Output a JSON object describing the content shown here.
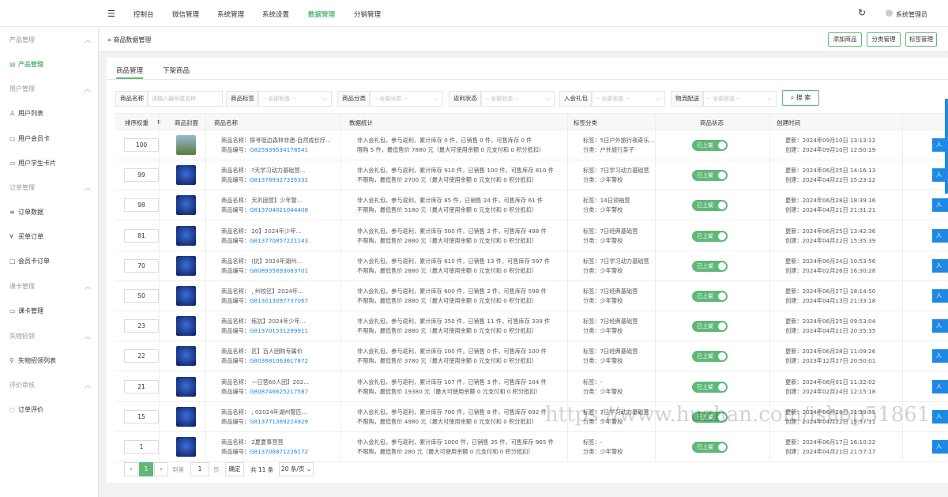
{
  "topbar": {
    "nav": [
      "控制台",
      "微信管理",
      "系统管理",
      "系统设置",
      "数据管理",
      "分销管理"
    ],
    "active_nav": "数据管理",
    "username": "系统管理员"
  },
  "sidebar": {
    "sections": [
      {
        "title": "产品管理",
        "items": [
          "产品管理"
        ]
      },
      {
        "title": "用户管理",
        "items": [
          "用户列表",
          "用户会员卡",
          "用户学生卡片"
        ]
      },
      {
        "title": "订单管理",
        "items": [
          "订单数据",
          "买单订单",
          "会员卡订单"
        ]
      },
      {
        "title": "课卡管理",
        "items": [
          "课卡管理"
        ]
      },
      {
        "title": "失物招领",
        "items": [
          "失物招领列表"
        ]
      },
      {
        "title": "评价审核",
        "items": [
          "订单评价"
        ]
      }
    ],
    "active_item": "产品管理"
  },
  "breadcrumb": "商品数据管理",
  "header_buttons": [
    "添加商品",
    "分类管理",
    "标签管理"
  ],
  "tabs": [
    "商品管理",
    "下架商品"
  ],
  "filters": [
    {
      "label": "商品名称",
      "placeholder": "请输入编号或名称"
    },
    {
      "label": "商品标签",
      "placeholder": "-- 全部标签 --"
    },
    {
      "label": "商品分类",
      "placeholder": "-- 全部分类 --"
    },
    {
      "label": "返利状态",
      "placeholder": "-- 全部状态 --"
    },
    {
      "label": "入会礼包",
      "placeholder": "-- 全部状态 --"
    },
    {
      "label": "物流配送",
      "placeholder": "-- 全部状态 --"
    }
  ],
  "search_label": "搜 索",
  "columns": [
    "排序权重",
    "商品封面",
    "商品名称",
    "数据统计",
    "标签分类",
    "商品状态",
    "创建时间"
  ],
  "rows": [
    {
      "sort": "100",
      "name": "商品名称：探寻瑶边森林非遗-自然成长疗...",
      "code": "G825939534178541",
      "stat1": "非入会礼包，参与返利，累计库存 0 件，已销售 0 件，可售库存 0 件",
      "stat2": "限购 5 件，最低售价 7880 元（最大可使用余额 0 元支付和 0 积分抵扣）",
      "tag": "标签：5日户外旅行夜奇乐...",
      "cat": "分类：户外旅行亲子",
      "status": "已上架",
      "updated": "更新：2024年09月10日 13:13:12",
      "created": "创建：2024年09月10日 12:50:19"
    },
    {
      "sort": "99",
      "name": "商品名称：            ?天学习动力基础营...",
      "code": "G813769327335331",
      "stat1": "非入会礼包，参与返利，累计库存 910 件，已销售 100 件，可售库存 810 件",
      "stat2": "不限购，最低售价 2700 元（最大可使用余额 0 元支付和 0 积分抵扣）",
      "tag": "标签：7日学习动力基础营",
      "cat": "分类：少年警校",
      "status": "已上架",
      "updated": "更新：2024年06月25日 14:16:13",
      "created": "创建：2024年04月22日 15:23:12"
    },
    {
      "sort": "98",
      "name": "商品名称：            天巩固营】少年警...",
      "code": "G813704021044408",
      "stat1": "非入会礼包，参与返利，累计库存 85 件，已销售 24 件，可售库存 61 件",
      "stat2": "不限购，最低售价 5180 元（最大可使用余额 0 元支付和 0 积分抵扣）",
      "tag": "标签：14日领袖营",
      "cat": "分类：少年警校",
      "status": "已上架",
      "updated": "更新：2024年06月28日 18:39:16",
      "created": "创建：2024年04月21日 21:31:21"
    },
    {
      "sort": "81",
      "name": "商品名称：            20】2024年少年...",
      "code": "G813770857221143",
      "stat1": "非入会礼包，参与返利，累计库存 500 件，已销售 2 件，可售库存 498 件",
      "stat2": "不限购，最低售价 2880 元（最大可使用余额 0 元支付和 0 积分抵扣）",
      "tag": "标签：7日经典基础营",
      "cat": "分类：少年警校",
      "status": "已上架",
      "updated": "更新：2024年06月25日 13:42:36",
      "created": "创建：2024年04月22日 15:35:39"
    },
    {
      "sort": "70",
      "name": "商品名称：            (抗】2024年湖州...",
      "code": "G808935893083701",
      "stat1": "非入会礼包，参与返利，累计库存 610 件，已销售 13 件，可售库存 597 件",
      "stat2": "不限购，最低售价 2880 元（最大可使用余额 0 元支付和 0 积分抵扣）",
      "tag": "标签：7日学习动力基础营",
      "cat": "分类：少年警校",
      "status": "已上架",
      "updated": "更新：2024年06月24日 10:53:56",
      "created": "创建：2024年02月26日 16:30:28"
    },
    {
      "sort": "50",
      "name": "商品名称：  ,          州校区】2024年...",
      "code": "G813013097737067",
      "stat1": "非入会礼包，参与返利，累计库存 600 件，已销售 2 件，可售库存 598 件",
      "stat2": "不限购，最低售价 2880 元（最大可使用余额 0 元支付和 0 积分抵扣）",
      "tag": "标签：7日经典基础营",
      "cat": "分类：少年警校",
      "status": "已上架",
      "updated": "更新：2024年06月27日 18:14:50",
      "created": "创建：2024年04月13日 21:33:18"
    },
    {
      "sort": "23",
      "name": "商品名称：            练抗】2024年少年...",
      "code": "G813701531299911",
      "stat1": "非入会礼包，参与返利，累计库存 350 件，已销售 11 件，可售库存 339 件",
      "stat2": "不限购，最低售价 2880 元（最大可使用余额 0 元支付和 0 积分抵扣）",
      "tag": "标签：7日经典基础营",
      "cat": "分类：少年警校",
      "status": "已上架",
      "updated": "更新：2024年06月25日 09:53:04",
      "created": "创建：2024年04月21日 20:35:35"
    },
    {
      "sort": "22",
      "name": "商品名称：            区】百人团购专属价",
      "code": "G803681063617872",
      "stat1": "非入会礼包，参与返利，累计库存 100 件，已销售 0 件，可售库存 100 件",
      "stat2": "不限购，最低售价 3780 元（最大可使用余额 0 元支付和 0 积分抵扣）",
      "tag": "标签：7日经典基础营",
      "cat": "分类：少年警校",
      "status": "已上架",
      "updated": "更新：2024年06月28日 11:09:26",
      "created": "创建：2023年12月27日 20:50:01"
    },
    {
      "sort": "21",
      "name": "商品名称：            一日营60人团】202...",
      "code": "G808746625217587",
      "stat1": "非入会礼包，参与返利，累计库存 107 件，已销售 3 件，可售库存 104 件",
      "stat2": "不限购，最低售价 19380 元（最大可使用余额 0 元支付和 0 积分抵扣）",
      "tag": "标签：-",
      "cat": "分类：少年警校",
      "status": "已上架",
      "updated": "更新：2024年08月01日 11:32:02",
      "created": "创建：2024年02月24日 12:15:18"
    },
    {
      "sort": "15",
      "name": "商品名称：  ;          02024年湖州警匹...",
      "code": "G813771369224929",
      "stat1": "非入会礼包，参与返利，累计库存 700 件，已销售 8 件，可售库存 692 件",
      "stat2": "不限购，最低售价 4980 元（最大可使用余额 0 元支付和 0 积分抵扣）",
      "tag": "标签：7日学习动力基础营",
      "cat": "分类：少年警校",
      "status": "已上架",
      "updated": "更新：2024年06月28日 11:39:55",
      "created": "创建：2024年04月22日 15:37:11"
    },
    {
      "sort": "1",
      "name": "商品名称：            2夏夏事营营",
      "code": "G813706871226172",
      "stat1": "非入会礼包，参与返利，累计库存 1000 件，已销售 35 件，可售库存 965 件",
      "stat2": "不限购，最低售价 280 元（最大可使用余额 0 元支付和 0 积分抵扣）",
      "tag": "标签：-",
      "cat": "分类：少年警校",
      "status": "已上架",
      "updated": "更新：2024年06月17日 16:10:22",
      "created": "创建：2024年04月21日 21:57:17"
    }
  ],
  "action_label": "入",
  "pager": {
    "current": "1",
    "goto_label": "到第",
    "goto_value": "1",
    "page_unit": "页",
    "confirm": "确定",
    "total": "共 11 条",
    "per_page": "20 条/页"
  },
  "watermark": "https://www.huzhan.com/ishop51861"
}
